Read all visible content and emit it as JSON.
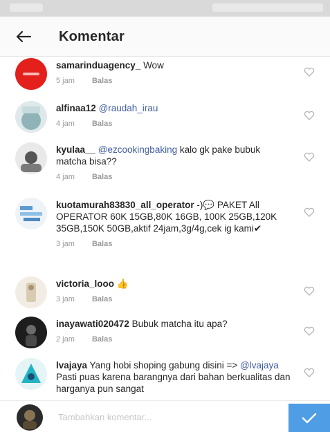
{
  "header": {
    "title": "Komentar",
    "back_icon": "arrow-left-icon"
  },
  "comments": [
    {
      "username": "samarinduagency_",
      "segments": [
        " Wow"
      ],
      "time": "5 jam",
      "reply": "Balas"
    },
    {
      "username": "alfinaa12",
      "mention": "@raudah_irau",
      "time": "4 jam",
      "reply": "Balas"
    },
    {
      "username": "kyulaa__",
      "mention": "@ezcookingbaking",
      "text": " kalo gk pake bubuk matcha bisa??",
      "time": "4 jam",
      "reply": "Balas"
    },
    {
      "username": "kuotamurah83830_all_operator",
      "text": " -)💬 PAKET All OPERATOR 60K 15GB,80K 16GB, 100K 25GB,120K 35GB,150K 50GB,aktif 24jam,3g/4g,cek ig kami✔",
      "time": "3 jam",
      "reply": "Balas"
    },
    {
      "username": "victoria_looo",
      "text": " 👍",
      "time": "3 jam",
      "reply": "Balas"
    },
    {
      "username": "inayawati020472",
      "text": " Bubuk matcha itu apa?",
      "time": "2 jam",
      "reply": "Balas"
    },
    {
      "username": "lvajaya",
      "text": " Yang hobi shoping gabung disini =>",
      "mention": "@lvajaya",
      "text2": "Pasti puas karena barangnya dari bahan berkualitas dan harganya pun sangat"
    }
  ],
  "composer": {
    "placeholder": "Tambahkan komentar...",
    "send_icon": "checkmark-icon"
  },
  "colors": {
    "header_bg": "#fafafa",
    "mention": "#3f5da0",
    "meta": "#999999",
    "send_button": "#4f9de4"
  }
}
